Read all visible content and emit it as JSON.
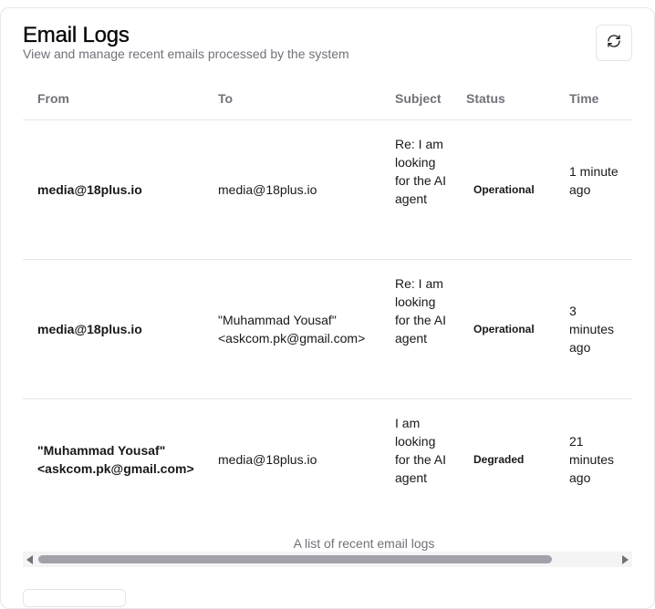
{
  "header": {
    "title": "Email Logs",
    "subtitle": "View and manage recent emails processed by the system",
    "refresh_icon": "refresh-icon"
  },
  "table": {
    "columns": [
      "From",
      "To",
      "Subject",
      "Status",
      "Time"
    ],
    "rows": [
      {
        "from": "media@18plus.io",
        "to": "media@18plus.io",
        "subject": "Re: I am looking for the AI agent",
        "status": "Operational",
        "time": "1 minute ago"
      },
      {
        "from": "media@18plus.io",
        "to": "\"Muhammad Yousaf\" <askcom.pk@gmail.com>",
        "subject": "Re: I am looking for the AI agent",
        "status": "Operational",
        "time": "3 minutes ago"
      },
      {
        "from": "\"Muhammad Yousaf\" <askcom.pk@gmail.com>",
        "to": "media@18plus.io",
        "subject": "I am looking for the AI agent",
        "status": "Degraded",
        "time": "21 minutes ago"
      }
    ],
    "caption": "A list of recent email logs"
  }
}
